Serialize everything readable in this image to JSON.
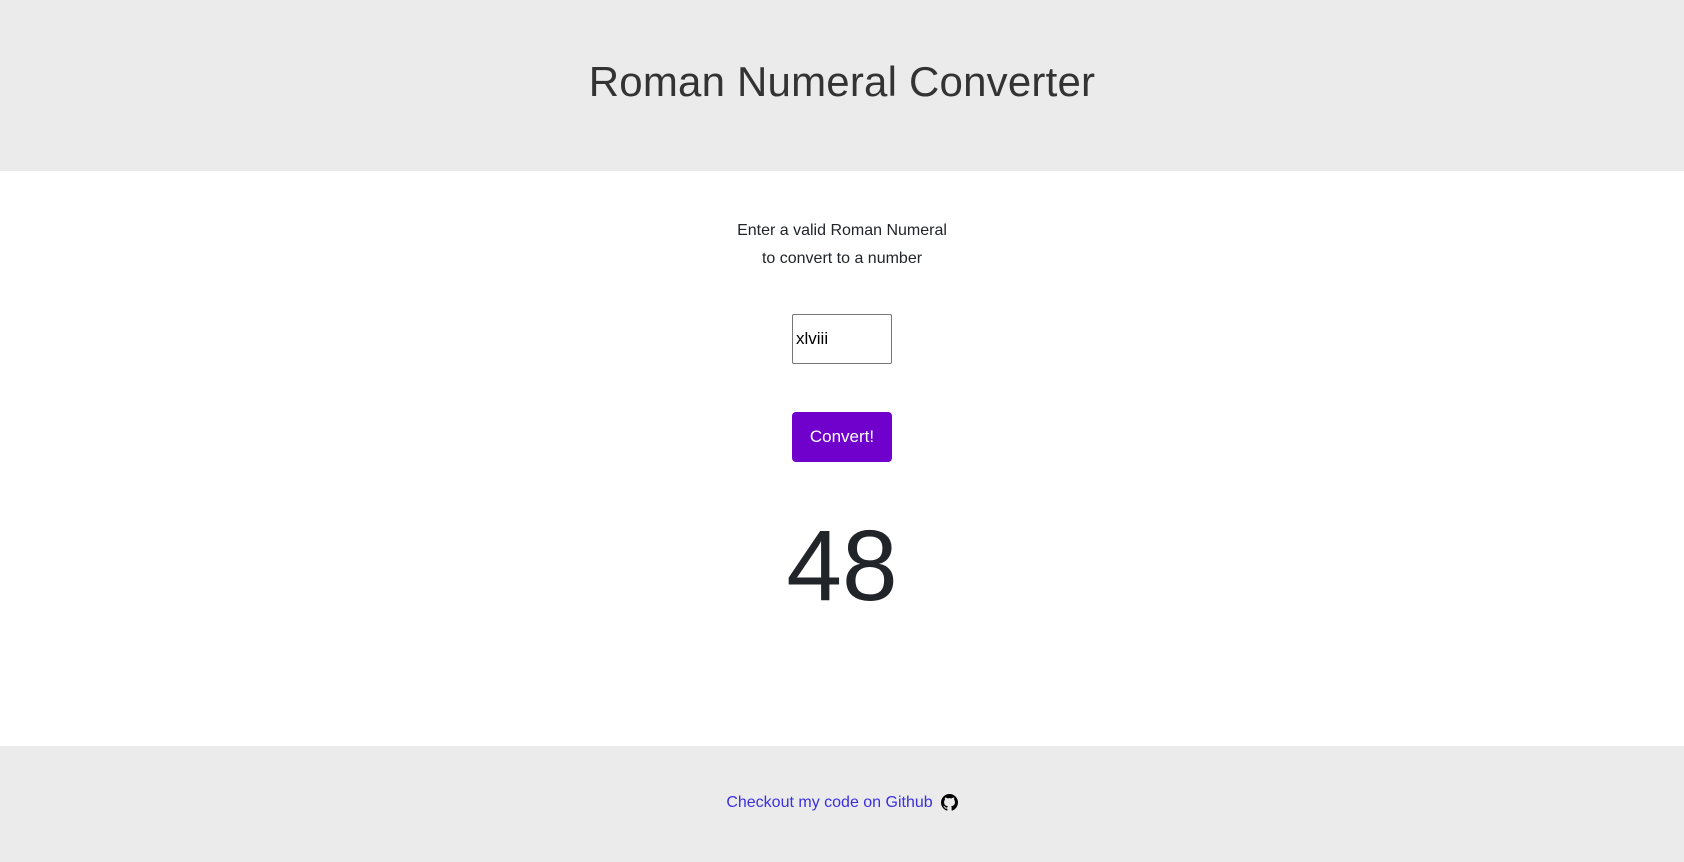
{
  "header": {
    "title": "Roman Numeral Converter"
  },
  "main": {
    "instructions_line1": "Enter a valid Roman Numeral",
    "instructions_line2": "to convert to a number",
    "input_value": "xlviii",
    "convert_label": "Convert!",
    "result": "48"
  },
  "footer": {
    "link_text": "Checkout my code on Github",
    "icon": "github-icon"
  },
  "colors": {
    "header_bg": "#ebebeb",
    "button_bg": "#7000cc",
    "link": "#3b2fe0",
    "text": "#212529"
  }
}
